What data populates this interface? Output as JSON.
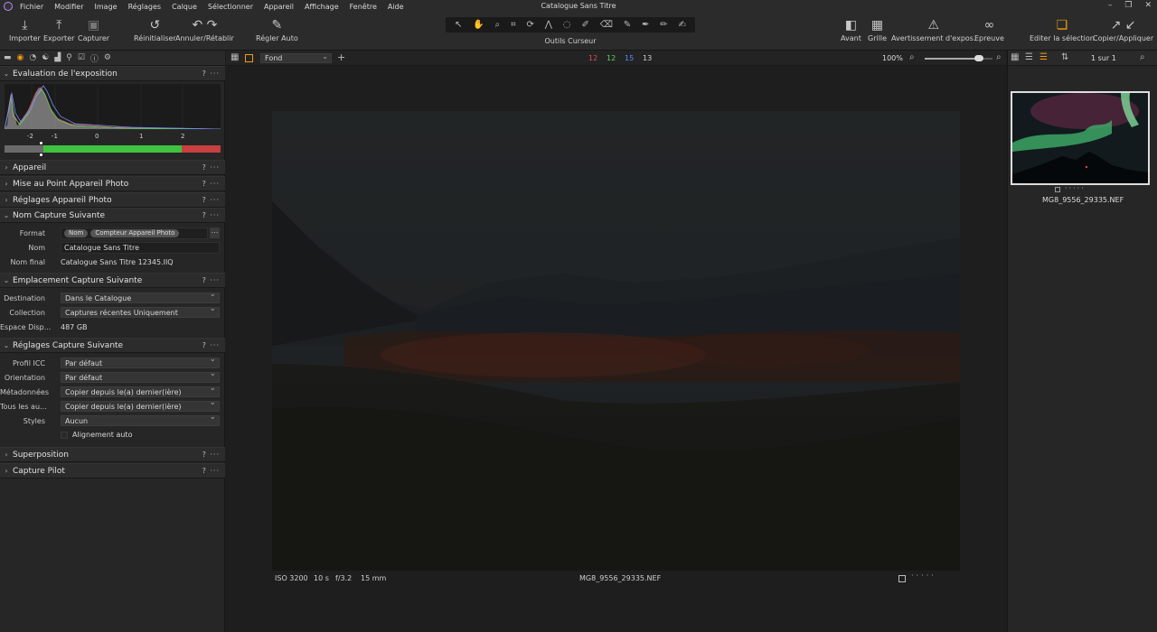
{
  "menu": [
    "Fichier",
    "Modifier",
    "Image",
    "Réglages",
    "Calque",
    "Sélectionner",
    "Appareil",
    "Affichage",
    "Fenêtre",
    "Aide"
  ],
  "window_title": "Catalogue Sans Titre",
  "toolbar": {
    "importer": "Importer",
    "exporter": "Exporter",
    "capturer": "Capturer",
    "reinitialiser": "Réinitialiser",
    "annuler": "Annuler/Rétablir",
    "regler_auto": "Régler Auto",
    "outils_curseur": "Outils Curseur",
    "avant": "Avant",
    "grille": "Grille",
    "avertissement": "Avertissement d'expos.",
    "epreuve": "Epreuve",
    "editer": "Editer la sélection",
    "copier": "Copier/Appliquer"
  },
  "left_panel": {
    "exposure": {
      "title": "Evaluation de l'exposition",
      "scale": [
        "-2",
        "-1",
        "0",
        "1",
        "2"
      ]
    },
    "sections_collapsed": [
      "Appareil",
      "Mise au Point Appareil Photo",
      "Réglages Appareil Photo"
    ],
    "nom_capture": {
      "title": "Nom Capture Suivante",
      "format_label": "Format",
      "format_tokens": [
        "Nom",
        "Compteur Appareil Photo"
      ],
      "nom_label": "Nom",
      "nom_value": "Catalogue Sans Titre",
      "nom_final_label": "Nom final",
      "nom_final_value": "Catalogue Sans Titre 12345.IIQ"
    },
    "emplacement": {
      "title": "Emplacement Capture Suivante",
      "destination_label": "Destination",
      "destination_value": "Dans le Catalogue",
      "collection_label": "Collection",
      "collection_value": "Captures récentes Uniquement",
      "espace_label": "Espace Disp...",
      "espace_value": "487 GB"
    },
    "reglages_capture": {
      "title": "Réglages Capture Suivante",
      "rows": [
        {
          "label": "Profil ICC",
          "value": "Par défaut"
        },
        {
          "label": "Orientation",
          "value": "Par défaut"
        },
        {
          "label": "Métadonnées",
          "value": "Copier depuis le(a) dernier(ière)"
        },
        {
          "label": "Tous les au...",
          "value": "Copier depuis le(a) dernier(ière)"
        },
        {
          "label": "Styles",
          "value": "Aucun"
        }
      ],
      "alignement": "Alignement auto"
    },
    "sections_bottom": [
      "Superposition",
      "Capture Pilot"
    ]
  },
  "viewer": {
    "layer": "Fond",
    "counts": [
      {
        "value": "12",
        "color": "#e05050"
      },
      {
        "value": "12",
        "color": "#5fd05f"
      },
      {
        "value": "15",
        "color": "#5a8aff"
      },
      {
        "value": "13",
        "color": "#d0d0d0"
      }
    ],
    "zoom": "100%",
    "zoom_level": 0.85,
    "iso": "ISO 3200",
    "shutter": "10 s",
    "aperture": "f/3.2",
    "focal": "15 mm",
    "filename": "MG8_9556_29335.NEF"
  },
  "right_panel": {
    "page": "1 sur 1",
    "thumb_name": "MG8_9556_29335.NEF"
  },
  "colors": {
    "accent": "#f39c12"
  }
}
